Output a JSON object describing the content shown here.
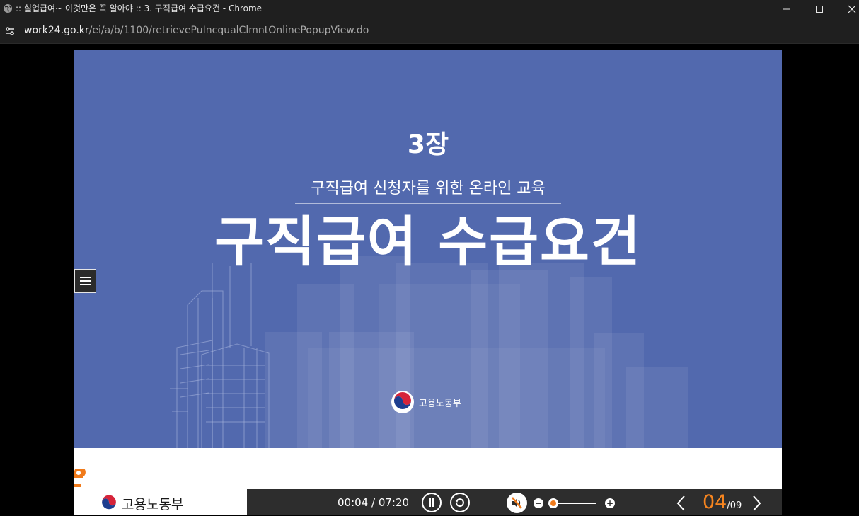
{
  "window": {
    "title": ":: 실업급여~ 이것만은 꼭 알아야 :: 3. 구직급여 수급요건 - Chrome"
  },
  "address_bar": {
    "host": "work24.go.kr",
    "path": "/ei/a/b/1100/retrievePuIncqualClmntOnlinePopupView.do"
  },
  "slide": {
    "chapter": "3장",
    "subtitle": "구직급여 신청자를 위한 온라인 교육",
    "headline": "구직급여 수급요건",
    "ministry": "고용노동부",
    "background_color": "#5269ae"
  },
  "footer": {
    "ministry": "고용노동부"
  },
  "player": {
    "time_display": "00:04 / 07:20",
    "current_page": "04",
    "total_pages": "/09",
    "volume_level": 0.0,
    "accent_color": "#f7851f"
  }
}
